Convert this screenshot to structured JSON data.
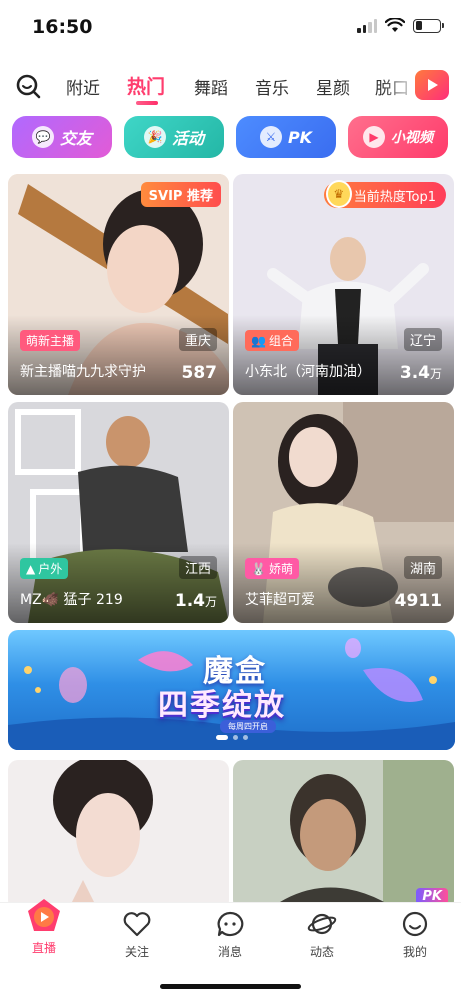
{
  "status": {
    "time": "16:50"
  },
  "tabs": {
    "items": [
      "附近",
      "热门",
      "舞蹈",
      "音乐",
      "星颜",
      "脱口"
    ],
    "active": "热门"
  },
  "categories": [
    {
      "label": "交友",
      "icon": "chat-bubble-icon"
    },
    {
      "label": "活动",
      "icon": "party-popper-icon"
    },
    {
      "label": "PK",
      "icon": "crossed-swords-icon"
    },
    {
      "label": "小视频",
      "icon": "play-button-icon"
    }
  ],
  "cards": [
    {
      "name": "新主播喵九九求守护",
      "count": "587",
      "count_unit": "",
      "location": "重庆",
      "tag": "萌新主播",
      "badge": "SVIP 推荐"
    },
    {
      "name": "小东北（河南加油）",
      "count": "3.4",
      "count_unit": "万",
      "location": "辽宁",
      "tag": "组合",
      "badge": "当前热度Top1"
    },
    {
      "name": "MZ🐗 猛子 219",
      "count": "1.4",
      "count_unit": "万",
      "location": "江西",
      "tag": "户外",
      "badge": ""
    },
    {
      "name": "艾菲超可爱",
      "count": "4911",
      "count_unit": "",
      "location": "湖南",
      "tag": "娇萌",
      "badge": ""
    }
  ],
  "banner": {
    "title_line1": "魔盒",
    "title_line2": "四季绽放",
    "subtitle": "每周四开启"
  },
  "card_pk_badge": "PK",
  "bottom_nav": [
    {
      "label": "直播",
      "icon": "live-icon",
      "active": true
    },
    {
      "label": "关注",
      "icon": "heart-icon",
      "active": false
    },
    {
      "label": "消息",
      "icon": "message-icon",
      "active": false
    },
    {
      "label": "动态",
      "icon": "planet-icon",
      "active": false
    },
    {
      "label": "我的",
      "icon": "smile-icon",
      "active": false
    }
  ],
  "colors": {
    "accent": "#ff3d6e"
  }
}
